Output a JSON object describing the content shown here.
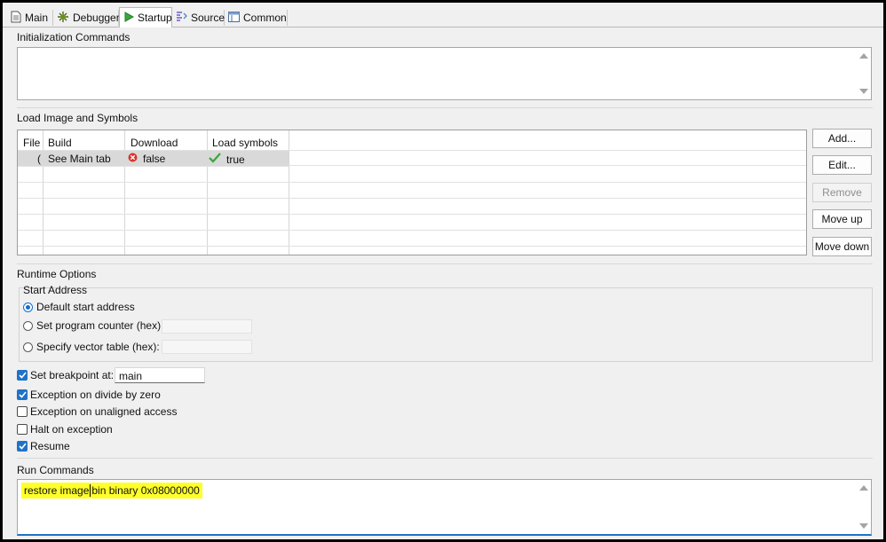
{
  "tabs": [
    {
      "label": "Main",
      "icon": "document-icon",
      "active": false
    },
    {
      "label": "Debugger",
      "icon": "bug-gear-icon",
      "active": false
    },
    {
      "label": "Startup",
      "icon": "play-icon",
      "active": true
    },
    {
      "label": "Source",
      "icon": "source-icon",
      "active": false
    },
    {
      "label": "Common",
      "icon": "window-icon",
      "active": false
    }
  ],
  "init": {
    "title": "Initialization Commands",
    "value": ""
  },
  "load": {
    "title": "Load Image and Symbols",
    "columns": [
      "File",
      "Build",
      "Download",
      "Load symbols"
    ],
    "row": {
      "file": "(",
      "build": "See Main tab",
      "download": "false",
      "load_symbols": "true"
    },
    "buttons": {
      "add": "Add...",
      "edit": "Edit...",
      "remove": "Remove",
      "move_up": "Move up",
      "move_down": "Move down"
    }
  },
  "runtime": {
    "title": "Runtime Options",
    "start_address": {
      "title": "Start Address",
      "default": "Default start address",
      "program_counter": "Set program counter (hex):",
      "vector_table": "Specify vector table (hex):",
      "selected": "default"
    },
    "breakpoint_label": "Set breakpoint at:",
    "breakpoint_value": "main",
    "options": {
      "breakpoint": true,
      "divide_by_zero": {
        "label": "Exception on divide by zero",
        "checked": true
      },
      "unaligned": {
        "label": "Exception on unaligned access",
        "checked": false
      },
      "halt": {
        "label": "Halt on exception",
        "checked": false
      },
      "resume": {
        "label": "Resume",
        "checked": true
      }
    }
  },
  "run": {
    "title": "Run Commands",
    "text_a": "restore image",
    "text_b": "bin binary 0x08000000"
  },
  "colors": {
    "accent": "#1f72c7",
    "highlight": "#ffff2a",
    "error": "#d9342b",
    "success": "#3aa63a"
  }
}
